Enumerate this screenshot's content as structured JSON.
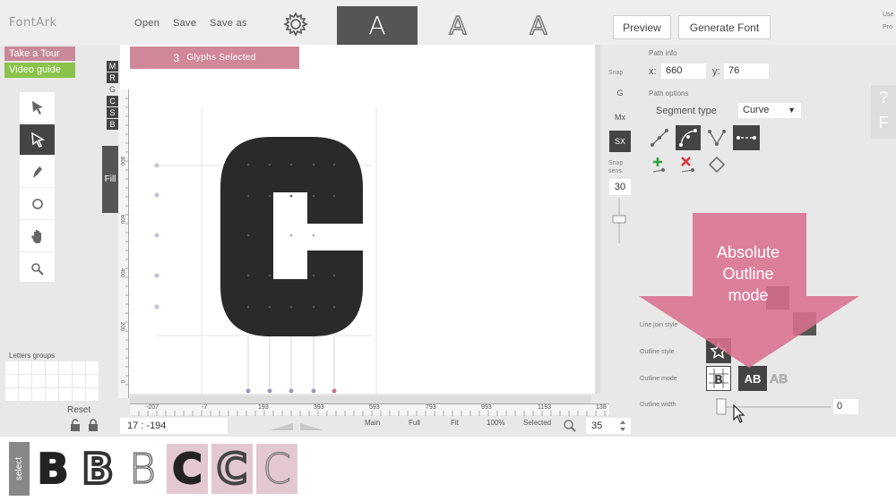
{
  "app": {
    "logo": "FontArk"
  },
  "menu": {
    "open": "Open",
    "save": "Save",
    "save_as": "Save as"
  },
  "modes": [
    "A",
    "A",
    "A"
  ],
  "toolbar": {
    "preview": "Preview",
    "generate": "Generate Font"
  },
  "rightedge": {
    "line1": "Use",
    "line2": "Pro"
  },
  "guides": {
    "tour": "Take a Tour",
    "video": "Video guide"
  },
  "side_letters": [
    "M",
    "R",
    "G",
    "C",
    "S",
    "B"
  ],
  "fill_tab": "Fill",
  "letters_groups": {
    "label": "Letters groups",
    "reset": "Reset"
  },
  "canvas": {
    "selection_count": "3",
    "selection_label": "Glyphs Selected",
    "ruler_h": [
      "-207",
      "-7",
      "193",
      "393",
      "593",
      "793",
      "993",
      "1193",
      "138"
    ],
    "ruler_v": [
      "800",
      "600",
      "400",
      "200",
      "0"
    ]
  },
  "bottombar": {
    "coord": "17 : -194",
    "main": "Main",
    "full": "Full",
    "fit": "Fit",
    "zoom100": "100%",
    "selected": "Selected",
    "zoom_value": "35"
  },
  "snap": {
    "label": "Snap",
    "g": "G",
    "mx": "Mx",
    "sx": "SX",
    "sens_label": "Snap sens.",
    "sens_value": "30"
  },
  "path": {
    "info_label": "Path info",
    "x_label": "x:",
    "x_value": "660",
    "y_label": "y:",
    "y_value": "76",
    "options_label": "Path options",
    "segment_type_label": "Segment type",
    "segment_type_value": "Curve",
    "line_join_label": "Line join style",
    "outline_style_label": "Outline style",
    "outline_mode_label": "Outline mode",
    "outline_width_label": "Outline width",
    "outline_width_value": "0",
    "mode_ab": "AB",
    "mode_ab2": "AB"
  },
  "help": {
    "q": "?",
    "f": "F"
  },
  "overlay": {
    "text_line1": "Absolute",
    "text_line2": "Outline",
    "text_line3": "mode",
    "color": "#d9708f"
  },
  "glyphs": {
    "select_label": "select",
    "items": [
      "B",
      "B",
      "B",
      "C",
      "C",
      "C"
    ]
  },
  "colors": {
    "accent": "#d08898",
    "dark": "#444444",
    "green": "#8bc34a"
  }
}
